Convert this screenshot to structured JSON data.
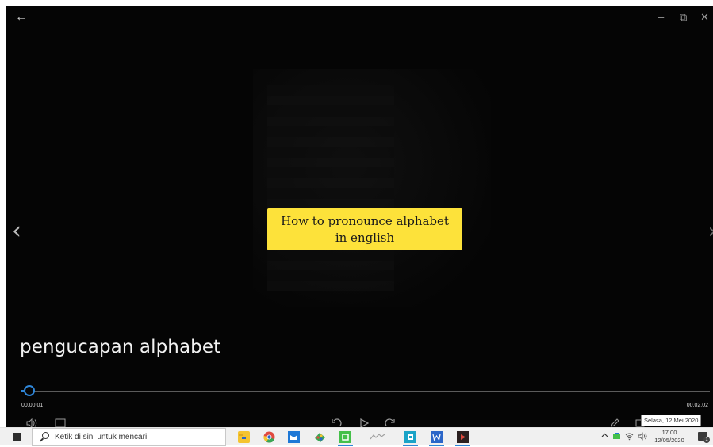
{
  "player": {
    "title_card_line1": "How to pronounce alphabet",
    "title_card_line2": "in english",
    "video_title": "pengucapan alphabet",
    "current_time": "00.00.01",
    "total_time": "00.02.02",
    "progress_fraction": 0.008,
    "accent_color": "#2f86d8",
    "title_card_color": "#fde23a",
    "nav_prev_glyph": "‹",
    "nav_next_glyph": "›",
    "back_glyph": "←",
    "minimize_glyph": "–",
    "restore_glyph": "⧉",
    "close_glyph": "✕",
    "icons": [
      "back-arrow-icon",
      "minimize-icon",
      "restore-icon",
      "close-icon",
      "chevron-left-icon",
      "chevron-right-icon",
      "volume-icon",
      "subtitles-icon",
      "rewind-icon",
      "play-icon",
      "forward-icon",
      "edit-icon",
      "fullscreen-icon"
    ]
  },
  "tooltip": {
    "date_text": "Selasa, 12 Mei 2020"
  },
  "taskbar": {
    "search_placeholder": "Ketik di sini untuk mencari",
    "apps": [
      {
        "name": "file-explorer-icon",
        "color": "#f4c430"
      },
      {
        "name": "chrome-icon",
        "color": "#e04a3f"
      },
      {
        "name": "mail-icon",
        "color": "#1e78d6"
      },
      {
        "name": "paint-icon",
        "color": "#3aa655"
      },
      {
        "name": "camtasia-icon",
        "color": "#45c04a"
      },
      {
        "name": "msi-icon",
        "color": "#b0b0b0"
      },
      {
        "name": "app-teal-icon",
        "color": "#1aa3c7"
      },
      {
        "name": "word-icon",
        "color": "#2b66c8"
      },
      {
        "name": "movies-tv-icon",
        "color": "#3a2a2a"
      }
    ],
    "clock_time": "17.00",
    "clock_date": "12/05/2020",
    "tray_icons": [
      "chevron-up-icon",
      "network-icon",
      "wifi-icon",
      "speaker-icon"
    ]
  }
}
